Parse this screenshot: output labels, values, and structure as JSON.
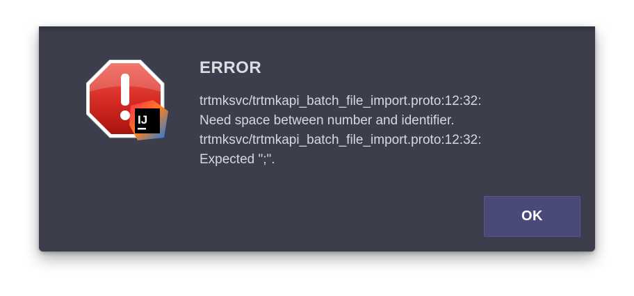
{
  "dialog": {
    "title": "ERROR",
    "message_lines": [
      "trtmksvc/trtmkapi_batch_file_import.proto:12:32:",
      "Need space between number and identifier.",
      "trtmksvc/trtmkapi_batch_file_import.proto:12:32:",
      "Expected \";\"."
    ],
    "ok_label": "OK",
    "icons": {
      "alert": "stop-alert-icon",
      "app_badge": "intellij-idea-icon",
      "app_badge_text": "IJ"
    },
    "colors": {
      "background": "#3c3f4b",
      "button": "#4a4a7a",
      "stop_sign": "#d42a22"
    }
  }
}
